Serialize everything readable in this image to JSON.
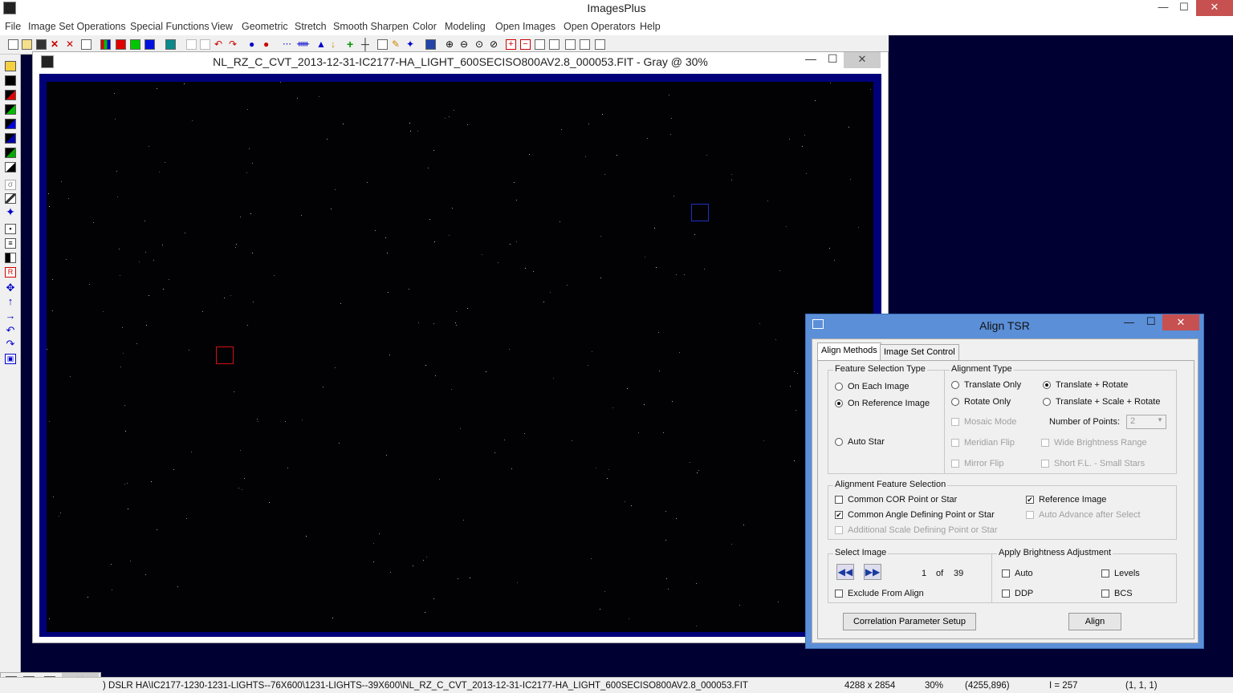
{
  "app": {
    "title": "ImagesPlus"
  },
  "window_controls": {
    "minimize": "—",
    "maximize": "☐",
    "close": "✕"
  },
  "menu": [
    "File",
    "Image Set Operations",
    "Special Functions",
    "View",
    "Geometric",
    "Stretch",
    "Smooth Sharpen",
    "Color",
    "Modeling",
    "Open Images",
    "Open Operators",
    "Help"
  ],
  "image_window": {
    "title": "NL_RZ_C_CVT_2013-12-31-IC2177-HA_LIGHT_600SECISO800AV2.8_000053.FIT - Gray @ 30%"
  },
  "dialog": {
    "title": "Align TSR",
    "tabs": [
      "Align Methods",
      "Image Set Control"
    ],
    "feature_selection": {
      "label": "Feature Selection Type",
      "options": [
        "On Each Image",
        "On Reference Image",
        "Auto Star"
      ],
      "selected": "On Reference Image"
    },
    "alignment_type": {
      "label": "Alignment Type",
      "options": [
        "Translate Only",
        "Translate + Rotate",
        "Rotate Only",
        "Translate + Scale + Rotate"
      ],
      "selected": "Translate + Rotate",
      "mosaic_mode": "Mosaic Mode",
      "num_points_label": "Number of Points:",
      "num_points": "2",
      "meridian_flip": "Meridian Flip",
      "wide_brightness": "Wide Brightness Range",
      "mirror_flip": "Mirror Flip",
      "short_fl": "Short F.L. - Small Stars"
    },
    "feature_selection_group": {
      "label": "Alignment Feature Selection",
      "common_cor": "Common COR Point or Star",
      "reference_image": "Reference Image",
      "common_angle": "Common Angle Defining Point or Star",
      "auto_advance": "Auto Advance after Select",
      "additional_scale": "Additional Scale Defining Point or Star"
    },
    "select_image": {
      "label": "Select Image",
      "current": "1",
      "of": "of",
      "total": "39",
      "exclude": "Exclude From Align"
    },
    "brightness": {
      "label": "Apply Brightness Adjustment",
      "auto": "Auto",
      "levels": "Levels",
      "ddp": "DDP",
      "bcs": "BCS"
    },
    "buttons": {
      "correlation": "Correlation Parameter Setup",
      "align": "Align"
    }
  },
  "status": {
    "path": ") DSLR HA\\IC2177-1230-1231-LIGHTS--76X600\\1231-LIGHTS--39X600\\NL_RZ_C_CVT_2013-12-31-IC2177-HA_LIGHT_600SECISO800AV2.8_000053.FIT",
    "dims": "4288 x 2854",
    "zoom": "30%",
    "coords": "(4255,896)",
    "intensity": "I = 257",
    "rgb": "(1, 1, 1)"
  },
  "colors": {
    "workspace": "#000033",
    "image_frame": "#000078",
    "dialog_border": "#5b8fd8",
    "close": "#c75050",
    "red_box": "#d01010",
    "blue_box": "#2030c0"
  }
}
